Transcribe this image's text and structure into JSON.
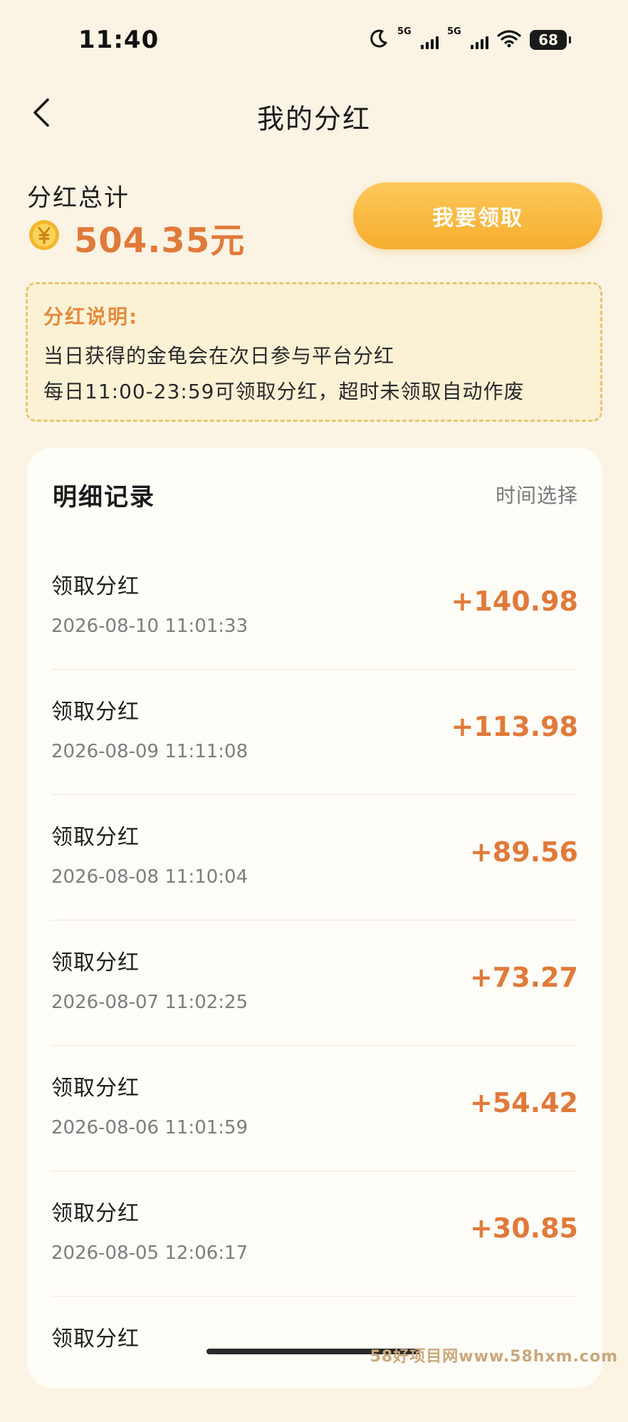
{
  "status_bar": {
    "time": "11:40",
    "sim1": "5G",
    "sim2": "5G",
    "battery": "68",
    "icons": [
      "moon-icon",
      "signal-icon",
      "signal-icon",
      "wifi-icon",
      "battery-icon"
    ]
  },
  "header": {
    "back_icon": "chevron-left-icon",
    "title": "我的分红"
  },
  "summary": {
    "label": "分红总计",
    "coin_icon": "yuan-coin-icon",
    "amount": "504.35元",
    "claim_button": "我要领取"
  },
  "notice": {
    "title": "分红说明:",
    "lines": [
      "当日获得的金龟会在次日参与平台分红",
      "每日11:00-23:59可领取分红，超时未领取自动作废"
    ]
  },
  "records": {
    "title": "明细记录",
    "filter": "时间选择",
    "items": [
      {
        "title": "领取分红",
        "time": "2026-08-10 11:01:33",
        "amount": "+140.98"
      },
      {
        "title": "领取分红",
        "time": "2026-08-09 11:11:08",
        "amount": "+113.98"
      },
      {
        "title": "领取分红",
        "time": "2026-08-08 11:10:04",
        "amount": "+89.56"
      },
      {
        "title": "领取分红",
        "time": "2026-08-07 11:02:25",
        "amount": "+73.27"
      },
      {
        "title": "领取分红",
        "time": "2026-08-06 11:01:59",
        "amount": "+54.42"
      },
      {
        "title": "领取分红",
        "time": "2026-08-05 12:06:17",
        "amount": "+30.85"
      },
      {
        "title": "领取分红",
        "time": "",
        "amount": ""
      }
    ]
  },
  "watermark": "58好项目网www.58hxm.com",
  "colors": {
    "background": "#fbf3e4",
    "accent_orange": "#e07a3a",
    "button_gold": "#f6ae2e",
    "notice_border": "#e8c66e"
  }
}
